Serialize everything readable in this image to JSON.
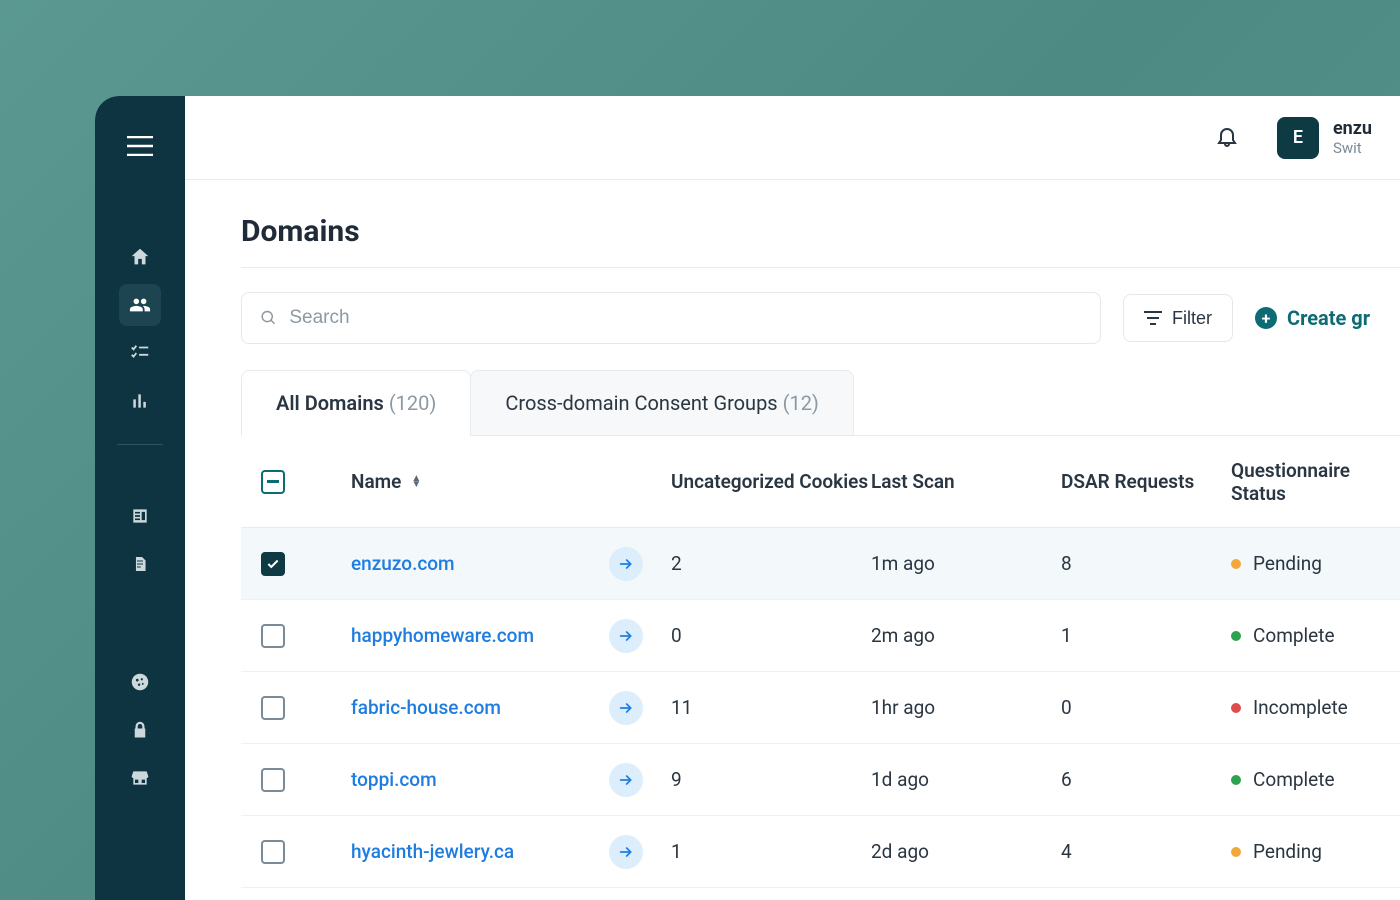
{
  "page": {
    "title": "Domains"
  },
  "account": {
    "avatar_initial": "E",
    "name": "enzu",
    "switch_label": "Swit"
  },
  "search": {
    "placeholder": "Search"
  },
  "toolbar": {
    "filter_label": "Filter",
    "create_label": "Create gr"
  },
  "tabs": [
    {
      "label": "All Domains",
      "count": "(120)",
      "active": true
    },
    {
      "label": "Cross-domain Consent Groups",
      "count": "(12)",
      "active": false
    }
  ],
  "columns": {
    "name": "Name",
    "uncategorized": "Uncategorized Cookies",
    "last_scan": "Last Scan",
    "dsar": "DSAR Requests",
    "questionnaire": "Questionnaire Status"
  },
  "status_labels": {
    "pending": "Pending",
    "complete": "Complete",
    "incomplete": "Incomplete"
  },
  "rows": [
    {
      "name": "enzuzo.com",
      "uncat": "2",
      "last_scan": "1m ago",
      "dsar": "8",
      "status": "pending",
      "checked": true
    },
    {
      "name": "happyhomeware.com",
      "uncat": "0",
      "last_scan": "2m ago",
      "dsar": "1",
      "status": "complete",
      "checked": false
    },
    {
      "name": "fabric-house.com",
      "uncat": "11",
      "last_scan": "1hr ago",
      "dsar": "0",
      "status": "incomplete",
      "checked": false
    },
    {
      "name": "toppi.com",
      "uncat": "9",
      "last_scan": "1d ago",
      "dsar": "6",
      "status": "complete",
      "checked": false
    },
    {
      "name": "hyacinth-jewlery.ca",
      "uncat": "1",
      "last_scan": "2d ago",
      "dsar": "4",
      "status": "pending",
      "checked": false
    }
  ]
}
